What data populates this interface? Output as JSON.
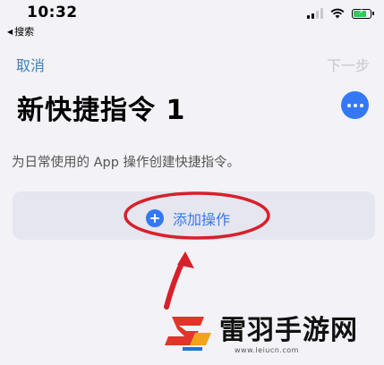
{
  "status_bar": {
    "time": "10:32",
    "back_label": "搜索"
  },
  "nav": {
    "cancel_label": "取消",
    "next_label": "下一步"
  },
  "shortcut": {
    "title": "新快捷指令 1",
    "subtitle": "为日常使用的 App 操作创建快捷指令。",
    "add_action_label": "添加操作"
  },
  "watermark": {
    "brand": "雷羽手游网",
    "url": "www.leiucn.com"
  },
  "colors": {
    "accent": "#3478f6",
    "link": "#3b82c4",
    "annotation": "#d8202a"
  }
}
